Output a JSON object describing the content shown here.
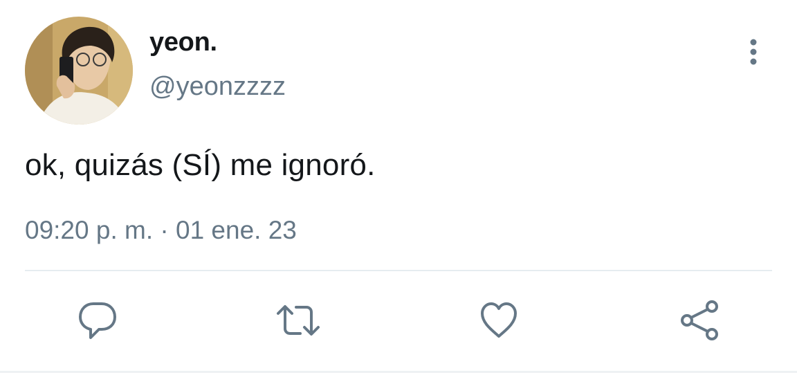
{
  "user": {
    "display_name": "yeon.",
    "handle": "@yeonzzzz",
    "avatar": "avatar-photo"
  },
  "tweet": {
    "text": "ok, quizás (SÍ) me ignoró.",
    "timestamp": "09:20 p. m. · 01 ene. 23"
  },
  "icons": {
    "more": "more-vertical-icon",
    "reply": "reply-bubble-icon",
    "retweet": "retweet-icon",
    "like": "heart-icon",
    "share": "share-icon"
  },
  "colors": {
    "text_primary": "#14171a",
    "text_secondary": "#657786",
    "divider": "#e6ecf0"
  }
}
